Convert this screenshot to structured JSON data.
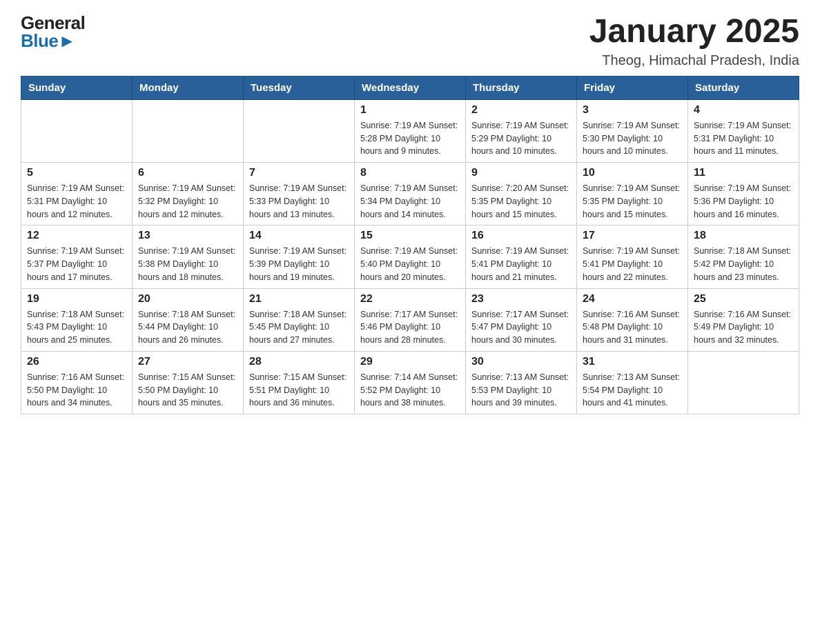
{
  "header": {
    "logo_line1": "General",
    "logo_line2": "Blue",
    "title": "January 2025",
    "subtitle": "Theog, Himachal Pradesh, India"
  },
  "calendar": {
    "weekdays": [
      "Sunday",
      "Monday",
      "Tuesday",
      "Wednesday",
      "Thursday",
      "Friday",
      "Saturday"
    ],
    "weeks": [
      [
        {
          "day": "",
          "info": ""
        },
        {
          "day": "",
          "info": ""
        },
        {
          "day": "",
          "info": ""
        },
        {
          "day": "1",
          "info": "Sunrise: 7:19 AM\nSunset: 5:28 PM\nDaylight: 10 hours and 9 minutes."
        },
        {
          "day": "2",
          "info": "Sunrise: 7:19 AM\nSunset: 5:29 PM\nDaylight: 10 hours and 10 minutes."
        },
        {
          "day": "3",
          "info": "Sunrise: 7:19 AM\nSunset: 5:30 PM\nDaylight: 10 hours and 10 minutes."
        },
        {
          "day": "4",
          "info": "Sunrise: 7:19 AM\nSunset: 5:31 PM\nDaylight: 10 hours and 11 minutes."
        }
      ],
      [
        {
          "day": "5",
          "info": "Sunrise: 7:19 AM\nSunset: 5:31 PM\nDaylight: 10 hours and 12 minutes."
        },
        {
          "day": "6",
          "info": "Sunrise: 7:19 AM\nSunset: 5:32 PM\nDaylight: 10 hours and 12 minutes."
        },
        {
          "day": "7",
          "info": "Sunrise: 7:19 AM\nSunset: 5:33 PM\nDaylight: 10 hours and 13 minutes."
        },
        {
          "day": "8",
          "info": "Sunrise: 7:19 AM\nSunset: 5:34 PM\nDaylight: 10 hours and 14 minutes."
        },
        {
          "day": "9",
          "info": "Sunrise: 7:20 AM\nSunset: 5:35 PM\nDaylight: 10 hours and 15 minutes."
        },
        {
          "day": "10",
          "info": "Sunrise: 7:19 AM\nSunset: 5:35 PM\nDaylight: 10 hours and 15 minutes."
        },
        {
          "day": "11",
          "info": "Sunrise: 7:19 AM\nSunset: 5:36 PM\nDaylight: 10 hours and 16 minutes."
        }
      ],
      [
        {
          "day": "12",
          "info": "Sunrise: 7:19 AM\nSunset: 5:37 PM\nDaylight: 10 hours and 17 minutes."
        },
        {
          "day": "13",
          "info": "Sunrise: 7:19 AM\nSunset: 5:38 PM\nDaylight: 10 hours and 18 minutes."
        },
        {
          "day": "14",
          "info": "Sunrise: 7:19 AM\nSunset: 5:39 PM\nDaylight: 10 hours and 19 minutes."
        },
        {
          "day": "15",
          "info": "Sunrise: 7:19 AM\nSunset: 5:40 PM\nDaylight: 10 hours and 20 minutes."
        },
        {
          "day": "16",
          "info": "Sunrise: 7:19 AM\nSunset: 5:41 PM\nDaylight: 10 hours and 21 minutes."
        },
        {
          "day": "17",
          "info": "Sunrise: 7:19 AM\nSunset: 5:41 PM\nDaylight: 10 hours and 22 minutes."
        },
        {
          "day": "18",
          "info": "Sunrise: 7:18 AM\nSunset: 5:42 PM\nDaylight: 10 hours and 23 minutes."
        }
      ],
      [
        {
          "day": "19",
          "info": "Sunrise: 7:18 AM\nSunset: 5:43 PM\nDaylight: 10 hours and 25 minutes."
        },
        {
          "day": "20",
          "info": "Sunrise: 7:18 AM\nSunset: 5:44 PM\nDaylight: 10 hours and 26 minutes."
        },
        {
          "day": "21",
          "info": "Sunrise: 7:18 AM\nSunset: 5:45 PM\nDaylight: 10 hours and 27 minutes."
        },
        {
          "day": "22",
          "info": "Sunrise: 7:17 AM\nSunset: 5:46 PM\nDaylight: 10 hours and 28 minutes."
        },
        {
          "day": "23",
          "info": "Sunrise: 7:17 AM\nSunset: 5:47 PM\nDaylight: 10 hours and 30 minutes."
        },
        {
          "day": "24",
          "info": "Sunrise: 7:16 AM\nSunset: 5:48 PM\nDaylight: 10 hours and 31 minutes."
        },
        {
          "day": "25",
          "info": "Sunrise: 7:16 AM\nSunset: 5:49 PM\nDaylight: 10 hours and 32 minutes."
        }
      ],
      [
        {
          "day": "26",
          "info": "Sunrise: 7:16 AM\nSunset: 5:50 PM\nDaylight: 10 hours and 34 minutes."
        },
        {
          "day": "27",
          "info": "Sunrise: 7:15 AM\nSunset: 5:50 PM\nDaylight: 10 hours and 35 minutes."
        },
        {
          "day": "28",
          "info": "Sunrise: 7:15 AM\nSunset: 5:51 PM\nDaylight: 10 hours and 36 minutes."
        },
        {
          "day": "29",
          "info": "Sunrise: 7:14 AM\nSunset: 5:52 PM\nDaylight: 10 hours and 38 minutes."
        },
        {
          "day": "30",
          "info": "Sunrise: 7:13 AM\nSunset: 5:53 PM\nDaylight: 10 hours and 39 minutes."
        },
        {
          "day": "31",
          "info": "Sunrise: 7:13 AM\nSunset: 5:54 PM\nDaylight: 10 hours and 41 minutes."
        },
        {
          "day": "",
          "info": ""
        }
      ]
    ]
  }
}
